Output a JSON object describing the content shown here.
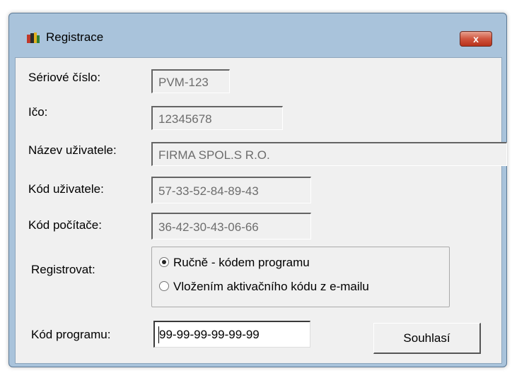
{
  "window": {
    "title": "Registrace",
    "close_glyph": "x"
  },
  "fields": {
    "serial": {
      "label": "Sériové číslo:",
      "value": "PVM-123"
    },
    "ico": {
      "label": "Ičo:",
      "value": "12345678"
    },
    "user_name": {
      "label": "Název uživatele:",
      "value": "FIRMA SPOL.S R.O."
    },
    "user_code": {
      "label": "Kód uživatele:",
      "value": "57-33-52-84-89-43"
    },
    "computer_code": {
      "label": "Kód počítače:",
      "value": "36-42-30-43-06-66"
    }
  },
  "register": {
    "label": "Registrovat:",
    "options": [
      {
        "label": "Ručně - kódem programu",
        "selected": true
      },
      {
        "label": "Vložením aktivačního kódu z e-mailu",
        "selected": false
      }
    ]
  },
  "program_code": {
    "label": "Kód programu:",
    "value": "99-99-99-99-99-99"
  },
  "submit_label": "Souhlasí",
  "colors": {
    "frame": "#a9c3db",
    "client": "#f0f0f0",
    "close": "#c8442e"
  }
}
